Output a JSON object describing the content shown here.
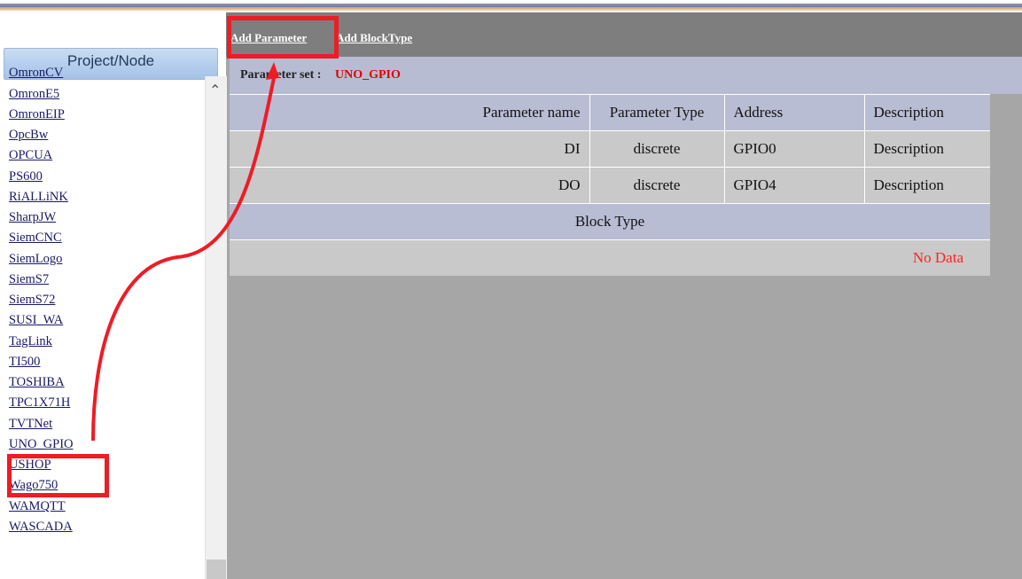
{
  "sidebar": {
    "header": "Project/Node",
    "items": [
      "OmronCV",
      "OmronE5",
      "OmronEIP",
      "OpcBw",
      "OPCUA",
      "PS600",
      "RiALLiNK",
      "SharpJW",
      "SiemCNC",
      "SiemLogo",
      "SiemS7",
      "SiemS72",
      "SUSI_WA",
      "TagLink",
      "TI500",
      "TOSHIBA",
      "TPC1X71H",
      "TVTNet",
      "UNO_GPIO",
      "USHOP",
      "Wago750",
      "WAMQTT",
      "WASCADA"
    ]
  },
  "toolbar": {
    "add_parameter": "Add Parameter",
    "add_blocktype": "Add BlockType"
  },
  "param_set": {
    "label": "Parameter set :",
    "value": "UNO_GPIO"
  },
  "table": {
    "headers": [
      "Parameter name",
      "Parameter Type",
      "Address",
      "Description"
    ],
    "rows": [
      [
        "DI",
        "discrete",
        "GPIO0",
        "Description"
      ],
      [
        "DO",
        "discrete",
        "GPIO4",
        "Description"
      ]
    ]
  },
  "block_type": {
    "header": "Block Type",
    "empty": "No Data"
  },
  "colors": {
    "highlight": "#ee1c25",
    "accent_value": "#e00000"
  }
}
